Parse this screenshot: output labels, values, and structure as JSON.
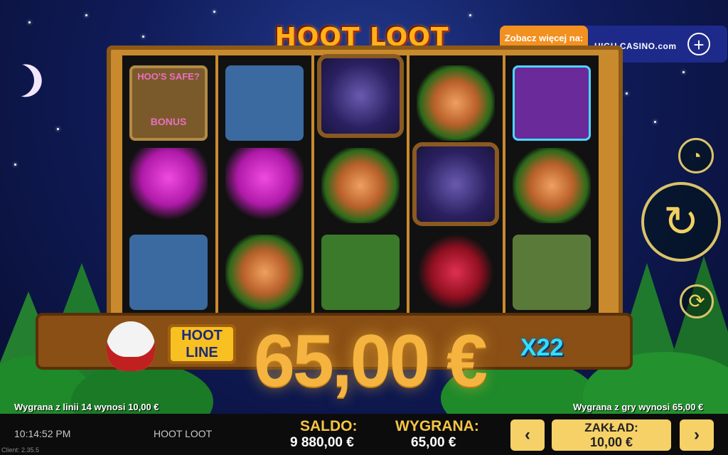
{
  "game": {
    "logo": "HOOT LOOT",
    "hoot_line_label_1": "HOOT",
    "hoot_line_label_2": "LINE",
    "multiplier": "X22",
    "big_win_amount": "65,00 €",
    "reels": [
      [
        "safe-bonus",
        "mushrooms",
        "moose"
      ],
      [
        "moose",
        "mushrooms",
        "leaf"
      ],
      [
        "wild-owl",
        "leaf",
        "bear"
      ],
      [
        "leaf",
        "wild-owl",
        "raspberries"
      ],
      [
        "eagle",
        "leaf",
        "hedgehog"
      ]
    ],
    "safe_symbol_text_1": "HOO'S SAFE?",
    "safe_symbol_text_2": "BONUS"
  },
  "promo": {
    "cta": "Zobacz więcej na:",
    "brand": "HIGH CASINO.com",
    "plus": "+"
  },
  "messages": {
    "line_win": "Wygrana z linii 14 wynosi 10,00 €",
    "game_win": "Wygrana z gry wynosi 65,00 €"
  },
  "status_bar": {
    "clock": "10:14:52 PM",
    "game_name": "HOOT LOOT",
    "client_version": "Client: 2.35.5",
    "saldo_label": "SALDO:",
    "saldo_value": "9 880,00 €",
    "wygrana_label": "WYGRANA:",
    "wygrana_value": "65,00 €",
    "bet_label": "ZAKŁAD:",
    "bet_value": "10,00 €",
    "bet_decrease": "‹",
    "bet_increase": "›"
  },
  "controls": {
    "spin_icon": "↻",
    "speed_icon": "◔",
    "autoplay_icon": "⟳"
  },
  "colors": {
    "accent_gold": "#f5c542",
    "multiplier_cyan": "#30e0ff",
    "promo_orange": "#f29020",
    "promo_blue": "#1d2a8a"
  }
}
